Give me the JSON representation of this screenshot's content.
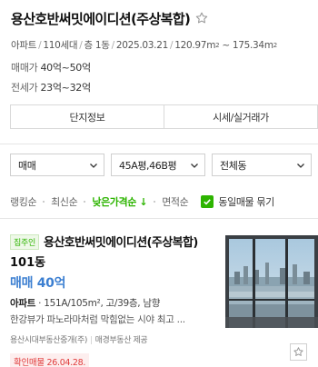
{
  "header": {
    "title": "용산호반써밋에이디션(주상복합)",
    "meta": {
      "type": "아파트",
      "households": "110세대",
      "floors": "층 1동",
      "date": "2025.03.21",
      "area_min": "120.97",
      "area_max": "175.34",
      "area_unit": "m",
      "area_sup": "2"
    },
    "sale": {
      "label": "매매가",
      "value": "40억~50억"
    },
    "lease": {
      "label": "전세가",
      "value": "23억~32억"
    }
  },
  "tabs": [
    {
      "label": "단지정보"
    },
    {
      "label": "시세/실거래가"
    }
  ],
  "filters": [
    {
      "value": "매매"
    },
    {
      "value": "45A평,46B평"
    },
    {
      "value": "전체동"
    }
  ],
  "sort": {
    "items": [
      {
        "label": "랭킹순",
        "active": false
      },
      {
        "label": "최신순",
        "active": false
      },
      {
        "label": "낮은가격순 ↓",
        "active": true
      },
      {
        "label": "면적순",
        "active": false
      }
    ],
    "same_listing_label": "동일매물 묶기",
    "same_listing_checked": true
  },
  "listing": {
    "badge": "집주인",
    "name": "용산호반써밋에이디션(주상복합)",
    "dong": "101동",
    "price": "매매 40억",
    "spec_type": "아파트",
    "spec_detail": "151A/105m², 고/39층, 남향",
    "description": "한강뷰가 파노라마처럼 막힘없는 시야 최고 ...",
    "agency": "용산시대부동산중개(주)",
    "provider": "매경부동산 제공",
    "confirm": "확인매물 26.04.28."
  },
  "colors": {
    "accent_green": "#2db400",
    "price_blue": "#3c7fd1",
    "confirm_red": "#e03a3a"
  },
  "icons": {
    "title_star": "star-outline-icon",
    "filter_chevron": "chevron-down-icon",
    "checkbox": "checkmark-icon",
    "favorite": "star-outline-icon"
  }
}
